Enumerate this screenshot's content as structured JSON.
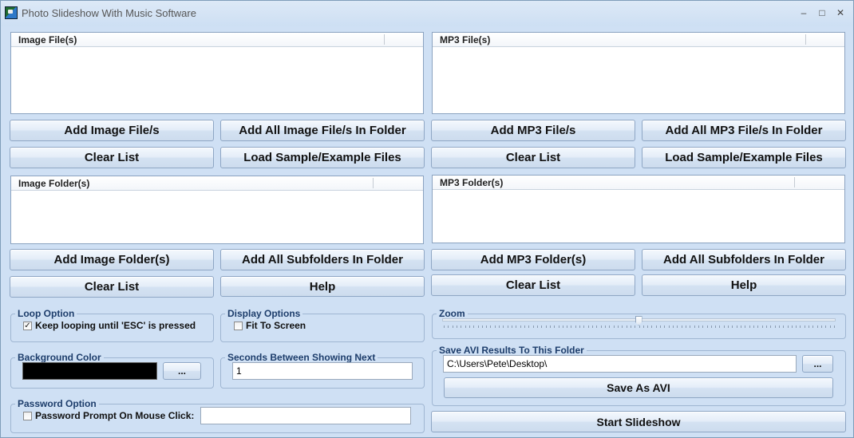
{
  "window": {
    "title": "Photo Slideshow With Music Software",
    "minimize": "–",
    "maximize": "□",
    "close": "✕"
  },
  "lists": {
    "image_files_header": "Image File(s)",
    "mp3_files_header": "MP3 File(s)",
    "image_folders_header": "Image Folder(s)",
    "mp3_folders_header": "MP3 Folder(s)"
  },
  "buttons": {
    "add_image_files": "Add Image File/s",
    "add_all_image_files_in_folder": "Add All Image File/s In Folder",
    "add_mp3_files": "Add MP3 File/s",
    "add_all_mp3_files_in_folder": "Add All MP3 File/s In Folder",
    "clear_list": "Clear List",
    "load_sample_files": "Load Sample/Example Files",
    "add_image_folders": "Add Image Folder(s)",
    "add_all_subfolders": "Add All Subfolders In Folder",
    "add_mp3_folders": "Add MP3 Folder(s)",
    "help": "Help",
    "browse": "...",
    "save_as_avi": "Save As AVI",
    "start_slideshow": "Start Slideshow"
  },
  "loop_option": {
    "legend": "Loop Option",
    "checkbox_label": "Keep looping until 'ESC' is pressed",
    "checked": true,
    "check_mark": "✓"
  },
  "display_options": {
    "legend": "Display Options",
    "checkbox_label": "Fit To Screen",
    "checked": false
  },
  "zoom": {
    "legend": "Zoom",
    "value_fraction": 0.5
  },
  "background_color": {
    "legend": "Background Color",
    "color": "#000000"
  },
  "seconds_between": {
    "legend": "Seconds Between Showing Next",
    "value": "1"
  },
  "save_avi": {
    "legend": "Save AVI Results To This Folder",
    "path": "C:\\Users\\Pete\\Desktop\\"
  },
  "password_option": {
    "legend": "Password Option",
    "checkbox_label": "Password Prompt On Mouse Click:",
    "checked": false,
    "value": ""
  },
  "colors": {
    "window_bg": "#cfe0f4",
    "legend_text": "#1d3d6b",
    "button_border": "#8ea6c4"
  }
}
